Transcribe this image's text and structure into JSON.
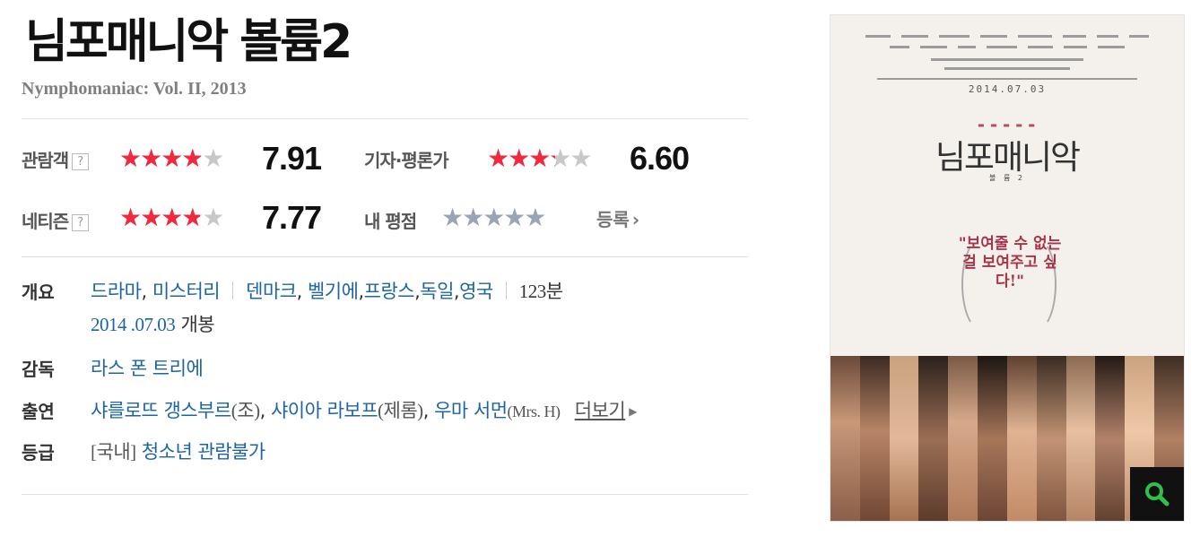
{
  "movie": {
    "title_ko": "님포매니악 볼륨2",
    "title_en": "Nymphomaniac: Vol. II, 2013"
  },
  "ratings": {
    "help_glyph": "?",
    "audience": {
      "label": "관람객",
      "score": "7.91",
      "value": 7.91,
      "max": 10
    },
    "critics": {
      "label": "기자·평론가",
      "score": "6.60",
      "value": 6.6,
      "max": 10
    },
    "netizen": {
      "label": "네티즌",
      "score": "7.77",
      "value": 7.77,
      "max": 10
    },
    "my_rating": {
      "label": "내 평점",
      "register_label": "등록",
      "value": 0
    }
  },
  "info": {
    "overview": {
      "label": "개요",
      "genres": [
        "드라마",
        "미스터리"
      ],
      "countries": [
        "덴마크",
        "벨기에",
        "프랑스",
        "독일",
        "영국"
      ],
      "runtime": "123분",
      "release_date": "2014 .07.03",
      "release_suffix": "개봉"
    },
    "director": {
      "label": "감독",
      "name": "라스 폰 트리에"
    },
    "cast": {
      "label": "출연",
      "actors": [
        {
          "name": "샤를로뜨 갱스부르",
          "role": "(조)"
        },
        {
          "name": "샤이아 라보프",
          "role": "(제롬)"
        },
        {
          "name": "우마 서먼",
          "role": "(Mrs. H)"
        }
      ],
      "more_label": "더보기"
    },
    "grade": {
      "label": "등급",
      "region": "[국내]",
      "rating": "청소년 관람불가"
    }
  },
  "poster": {
    "date": "2014.07.03",
    "title": "님포매니악",
    "volume": "볼 륨 2",
    "quote": "\"보여줄 수 없는 걸 보여주고 싶다!\""
  },
  "colors": {
    "star_filled": "#f0293e",
    "star_empty": "#c8c8c8",
    "star_mine": "#9aa4b3",
    "link": "#1e64a5",
    "zoom_icon": "#2fbf4a"
  }
}
